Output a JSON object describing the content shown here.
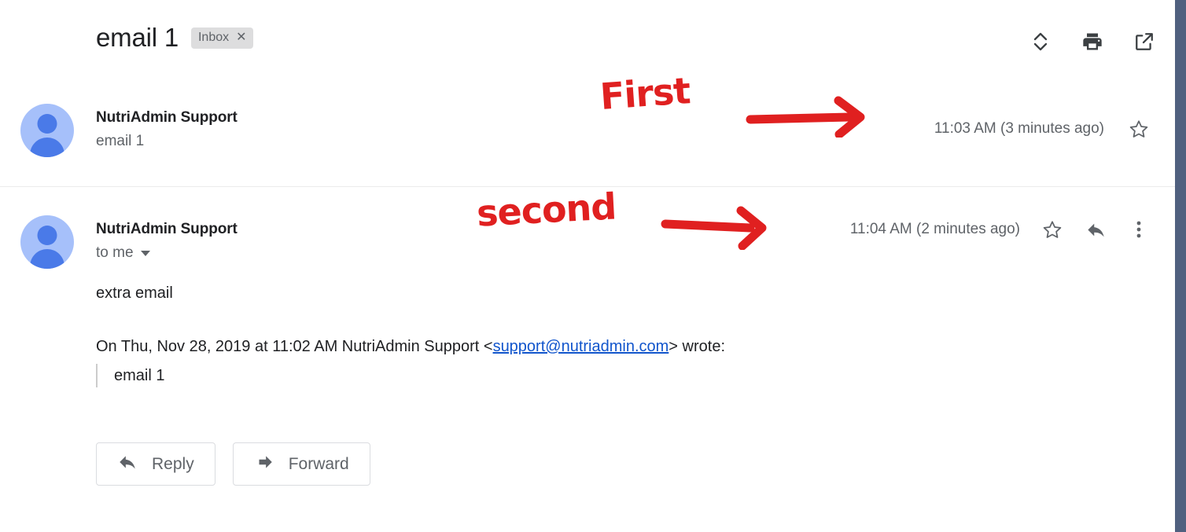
{
  "thread": {
    "subject": "email 1",
    "label": {
      "name": "Inbox",
      "remove_icon": "close-icon",
      "remove_glyph": "✕"
    }
  },
  "header_actions": [
    {
      "name": "collapse-all-icon",
      "label": "Collapse all"
    },
    {
      "name": "print-all-icon",
      "label": "Print all"
    },
    {
      "name": "open-in-new-window-icon",
      "label": "In new window"
    }
  ],
  "messages": [
    {
      "sender": "NutriAdmin Support",
      "subline": "email 1",
      "subline_has_caret": false,
      "time": "11:03 AM (3 minutes ago)",
      "actions": [
        {
          "name": "star-icon",
          "label": "Not starred"
        }
      ]
    },
    {
      "sender": "NutriAdmin Support",
      "subline": "to me",
      "subline_has_caret": true,
      "time": "11:04 AM (2 minutes ago)",
      "actions": [
        {
          "name": "star-icon",
          "label": "Not starred"
        },
        {
          "name": "reply-icon",
          "label": "Reply"
        },
        {
          "name": "more-options-icon",
          "label": "More"
        }
      ],
      "body": {
        "text": "extra email",
        "quote_intro_before": "On Thu, Nov 28, 2019 at 11:02 AM NutriAdmin Support <",
        "quote_link": "support@nutriadmin.com",
        "quote_intro_after": "> wrote:",
        "quoted_text": "email 1"
      }
    }
  ],
  "action_buttons": [
    {
      "name": "reply-button",
      "label": "Reply",
      "icon": "reply-arrow-icon"
    },
    {
      "name": "forward-button",
      "label": "Forward",
      "icon": "forward-arrow-icon"
    }
  ],
  "annotations": [
    {
      "name": "annotation-first",
      "text": "First"
    },
    {
      "name": "annotation-second",
      "text": "second"
    }
  ],
  "colors": {
    "annotation_red": "#e02020",
    "link_blue": "#1155cc",
    "avatar_bg": "#a6c0fa",
    "avatar_fg": "#4a7ae8",
    "chip_bg": "#ddddde",
    "edge_strip": "#50607f"
  }
}
